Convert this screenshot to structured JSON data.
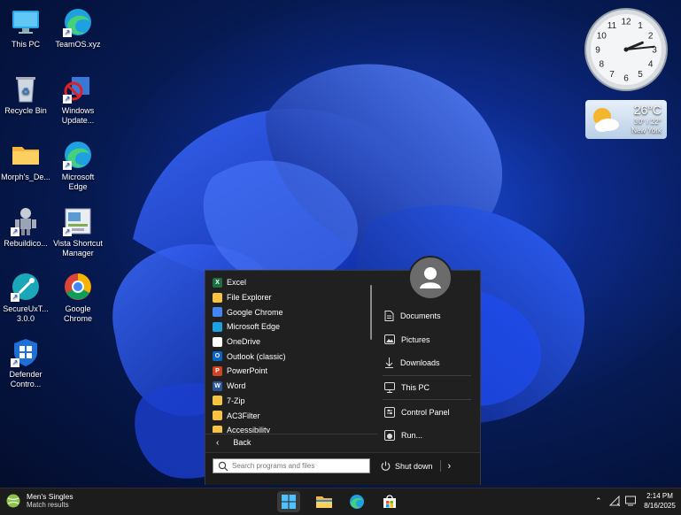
{
  "desktop_icons": [
    {
      "label": "This PC",
      "icon": "monitor-icon"
    },
    {
      "label": "TeamOS.xyz",
      "icon": "edge-icon"
    },
    {
      "label": "Recycle Bin",
      "icon": "recycle-bin-icon"
    },
    {
      "label": "Windows Update...",
      "icon": "windows-update-icon"
    },
    {
      "label": "Morph's_De...",
      "icon": "folder-icon"
    },
    {
      "label": "Microsoft Edge",
      "icon": "edge-icon"
    },
    {
      "label": "Rebuildico...",
      "icon": "robot-icon"
    },
    {
      "label": "Vista Shortcut Manager",
      "icon": "shortcut-manager-icon"
    },
    {
      "label": "SecureUxT... 3.0.0",
      "icon": "secure-ux-icon"
    },
    {
      "label": "Google Chrome",
      "icon": "chrome-icon"
    },
    {
      "label": "Defender Contro...",
      "icon": "shield-icon"
    }
  ],
  "clock_widget": {
    "numerals": [
      "12",
      "1",
      "2",
      "3",
      "4",
      "5",
      "6",
      "7",
      "8",
      "9",
      "10",
      "11"
    ],
    "hour": 2,
    "minute": 14
  },
  "weather": {
    "temp": "26°C",
    "range": "30° / 22°",
    "city": "New York",
    "icon": "partly-cloudy-icon"
  },
  "start_menu": {
    "programs": [
      {
        "label": "Excel",
        "icon": "excel-icon",
        "color": "#1d6f42",
        "glyph": "X"
      },
      {
        "label": "File Explorer",
        "icon": "file-explorer-icon",
        "color": "#f6c342",
        "glyph": ""
      },
      {
        "label": "Google Chrome",
        "icon": "chrome-icon",
        "color": "#4285f4",
        "glyph": ""
      },
      {
        "label": "Microsoft Edge",
        "icon": "edge-icon",
        "color": "#1fa0e0",
        "glyph": ""
      },
      {
        "label": "OneDrive",
        "icon": "onedrive-icon",
        "color": "#ffffff",
        "glyph": ""
      },
      {
        "label": "Outlook (classic)",
        "icon": "outlook-icon",
        "color": "#0a64c8",
        "glyph": "O"
      },
      {
        "label": "PowerPoint",
        "icon": "powerpoint-icon",
        "color": "#d04423",
        "glyph": "P"
      },
      {
        "label": "Word",
        "icon": "word-icon",
        "color": "#2b579a",
        "glyph": "W"
      },
      {
        "label": "7-Zip",
        "icon": "folder-icon",
        "color": "#f6c342",
        "glyph": ""
      },
      {
        "label": "AC3Filter",
        "icon": "folder-icon",
        "color": "#f6c342",
        "glyph": ""
      },
      {
        "label": "Accessibility",
        "icon": "folder-icon",
        "color": "#f6c342",
        "glyph": ""
      }
    ],
    "back_label": "Back",
    "right_items": [
      {
        "label": "Documents",
        "icon": "document-icon"
      },
      {
        "label": "Pictures",
        "icon": "picture-icon"
      },
      {
        "label": "Downloads",
        "icon": "download-icon"
      },
      {
        "label": "This PC",
        "icon": "computer-icon"
      },
      {
        "label": "Control Panel",
        "icon": "control-panel-icon"
      },
      {
        "label": "Run...",
        "icon": "run-icon"
      }
    ],
    "search_placeholder": "Search programs and files",
    "shutdown_label": "Shut down"
  },
  "taskbar": {
    "now_playing_title": "Men's Singles",
    "now_playing_subtitle": "Match results",
    "time": "2:14 PM",
    "date": "8/16/2025"
  }
}
